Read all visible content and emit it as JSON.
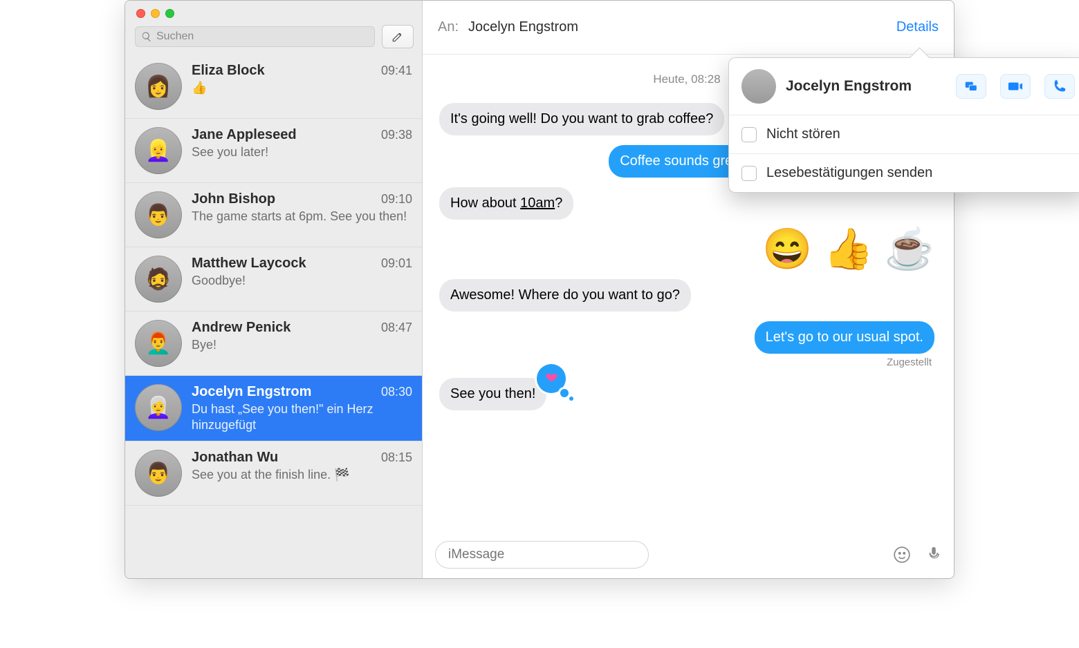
{
  "sidebar": {
    "search_placeholder": "Suchen",
    "conversations": [
      {
        "name": "Eliza Block",
        "time": "09:41",
        "preview": "👍"
      },
      {
        "name": "Jane Appleseed",
        "time": "09:38",
        "preview": "See you later!"
      },
      {
        "name": "John Bishop",
        "time": "09:10",
        "preview": "The game starts at 6pm. See you then!"
      },
      {
        "name": "Matthew Laycock",
        "time": "09:01",
        "preview": "Goodbye!"
      },
      {
        "name": "Andrew Penick",
        "time": "08:47",
        "preview": "Bye!"
      },
      {
        "name": "Jocelyn Engstrom",
        "time": "08:30",
        "preview": "Du hast „See you then!\" ein Herz hinzugefügt",
        "selected": true
      },
      {
        "name": "Jonathan Wu",
        "time": "08:15",
        "preview": "See you at the finish line. 🏁"
      }
    ]
  },
  "chat": {
    "to_label": "An:",
    "to_name": "Jocelyn Engstrom",
    "details_label": "Details",
    "date_divider": "Heute, 08:28",
    "messages": [
      {
        "side": "left",
        "kind": "text",
        "text": "It's going well! Do you want to grab coffee?"
      },
      {
        "side": "right",
        "kind": "text",
        "text": "Coffee sounds great! What time are you thinking?"
      },
      {
        "side": "left",
        "kind": "text",
        "text_pre": "How about ",
        "time_link": "10am",
        "text_post": "?"
      },
      {
        "side": "right",
        "kind": "emoji",
        "emoji": "😄 👍 ☕"
      },
      {
        "side": "left",
        "kind": "text",
        "text": "Awesome! Where do you want to go?"
      },
      {
        "side": "right",
        "kind": "text",
        "text": "Let's go to our usual spot.",
        "status": "Zugestellt"
      },
      {
        "side": "left",
        "kind": "text",
        "text": "See you then!",
        "reaction": "heart"
      }
    ],
    "compose_placeholder": "iMessage"
  },
  "details_popover": {
    "contact_name": "Jocelyn Engstrom",
    "do_not_disturb": "Nicht stören",
    "read_receipts": "Lesebestätigungen senden"
  }
}
